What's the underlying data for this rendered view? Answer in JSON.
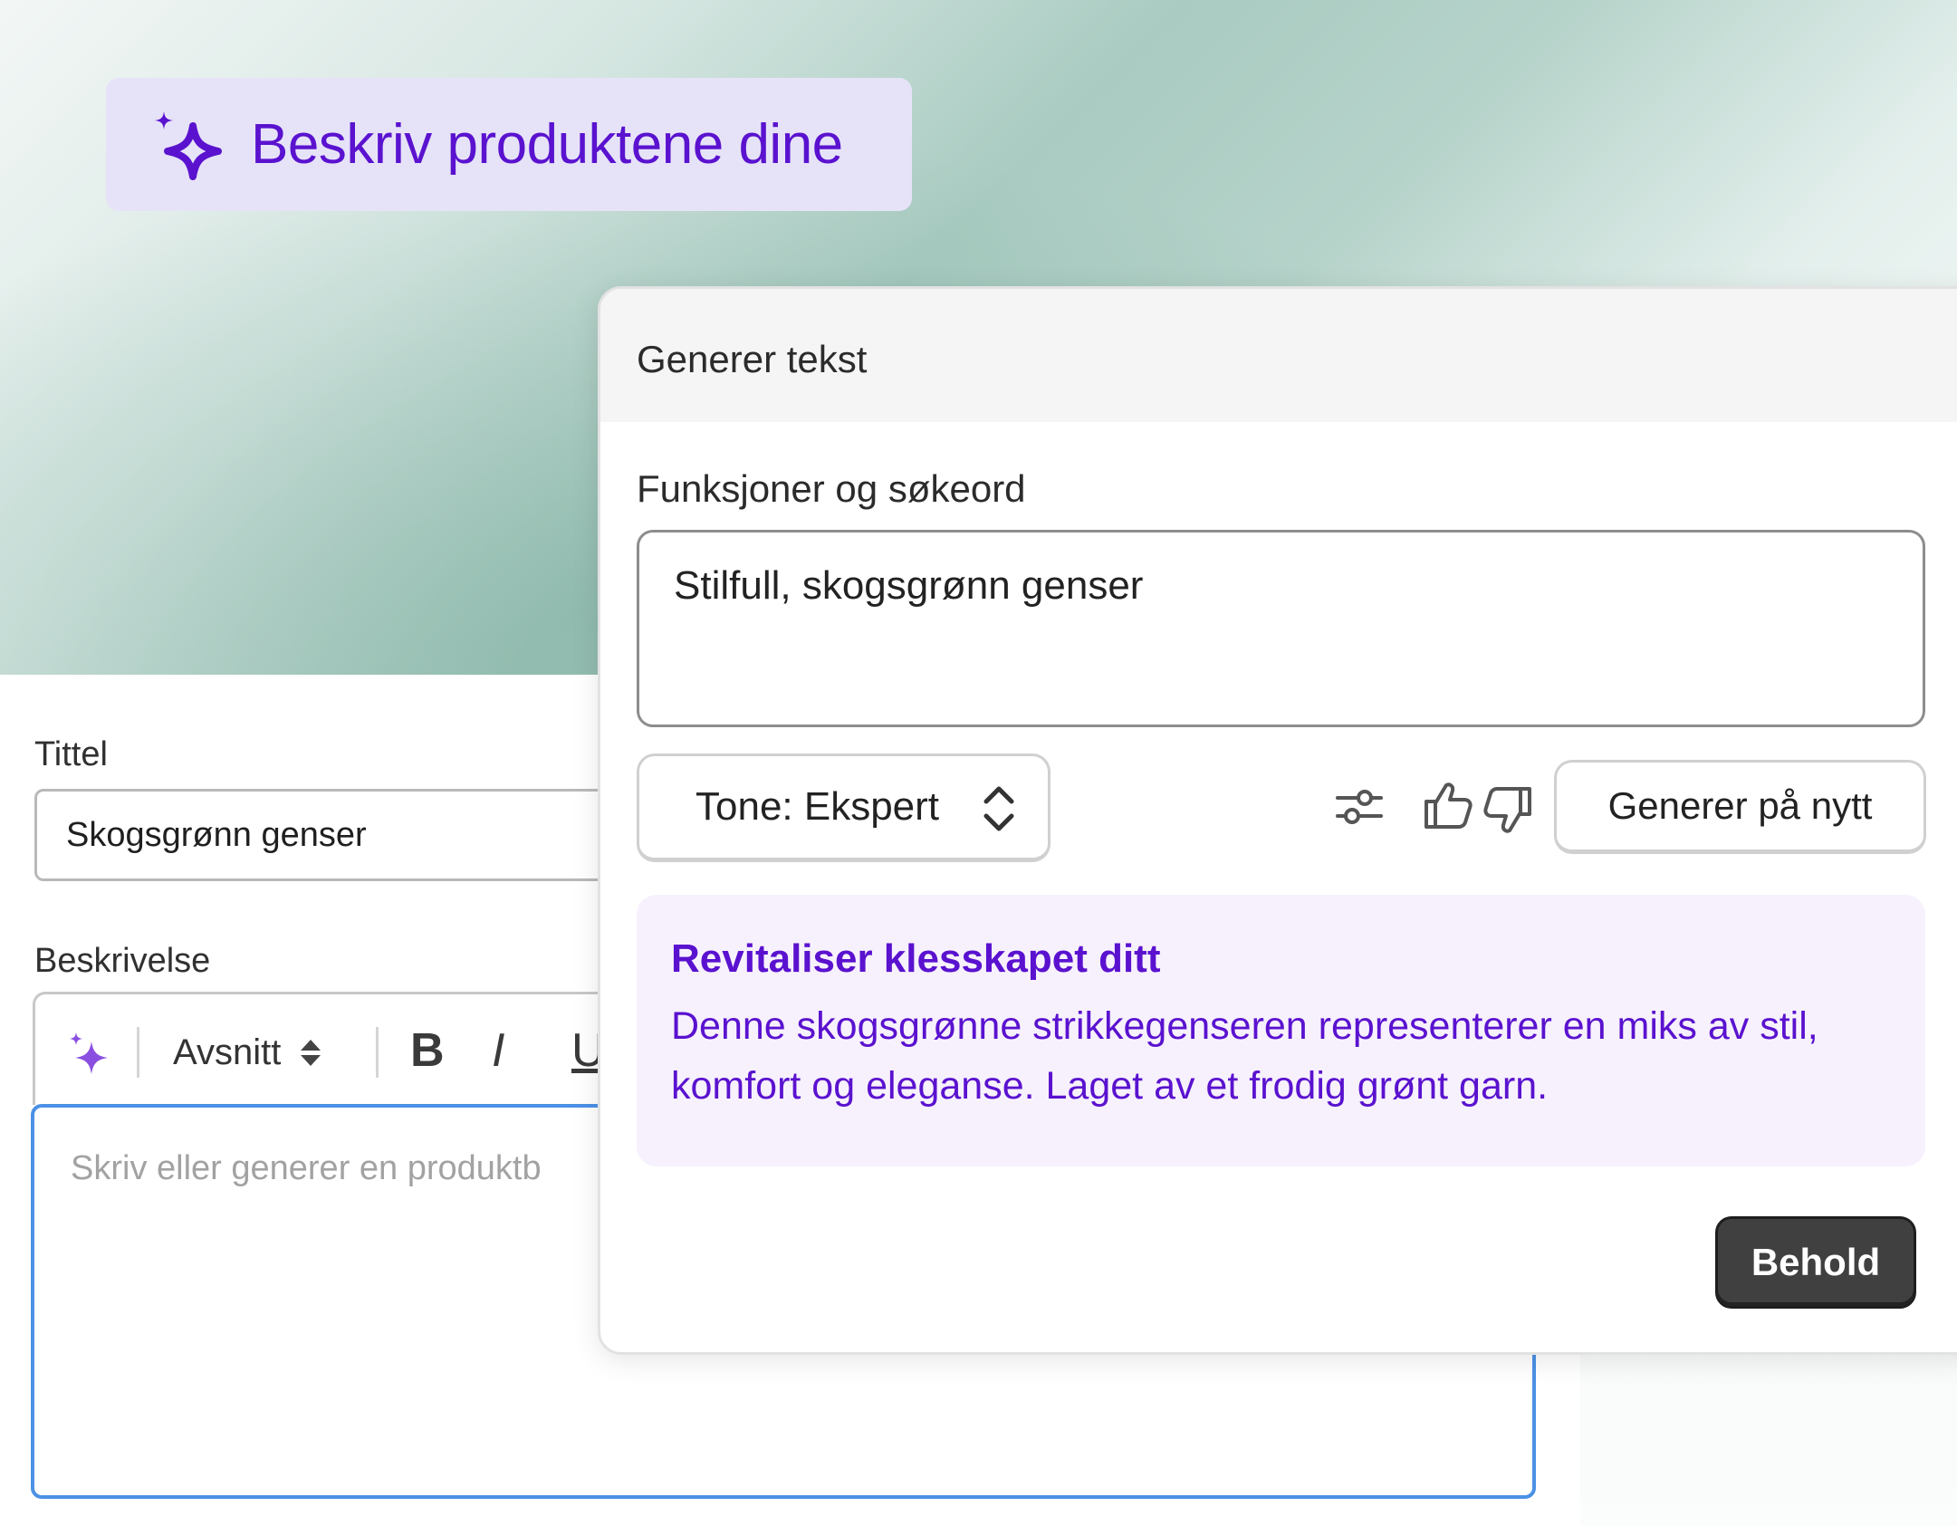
{
  "headline": {
    "text": "Beskriv produktene dine"
  },
  "form": {
    "title_label": "Tittel",
    "title_value": "Skogsgrønn genser",
    "description_label": "Beskrivelse",
    "toolbar": {
      "paragraph_style": "Avsnitt",
      "bold": "B",
      "italic": "I",
      "underline": "U"
    },
    "description_placeholder": "Skriv eller generer en produktb"
  },
  "dialog": {
    "title": "Generer tekst",
    "keywords_label": "Funksjoner og søkeord",
    "keywords_value": "Stilfull, skogsgrønn genser",
    "tone_label": "Tone: Ekspert",
    "regenerate_label": "Generer på nytt",
    "result": {
      "title": "Revitaliser klesskapet ditt",
      "body": "Denne skogsgrønne strikkegenseren representerer en miks av stil, komfort og eleganse. Laget av et frodig grønt garn."
    },
    "keep_label": "Behold"
  },
  "colors": {
    "accent": "#5a12cf",
    "focus_border": "#4b91e6",
    "result_bg": "#f7f1fd",
    "pill_bg": "#e6e3f8"
  },
  "icons": [
    "sparkle-icon",
    "sparkle-small-icon",
    "sort-icon",
    "sliders-icon",
    "thumbs-up-icon",
    "thumbs-down-icon",
    "chevron-updown-icon"
  ]
}
